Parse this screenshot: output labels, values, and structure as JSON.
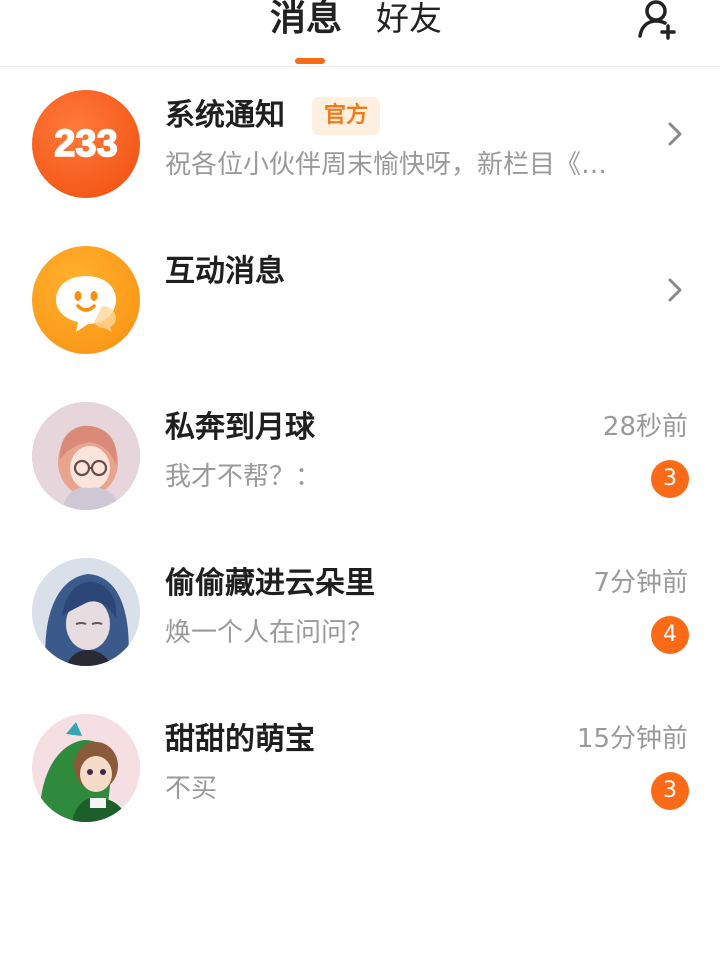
{
  "header": {
    "tabs": [
      {
        "label": "消息",
        "active": true
      },
      {
        "label": "好友",
        "active": false
      }
    ],
    "add_friend_icon": "add-person-icon",
    "accent_color": "#fa6a17"
  },
  "conversations": [
    {
      "name": "系统通知",
      "tag": "官方",
      "preview": "祝各位小伙伴周末愉快呀，新栏目《…",
      "avatar_text": "233",
      "avatar_icon": "logo-233-icon"
    },
    {
      "name": "互动消息",
      "preview": "",
      "avatar_icon": "chat-bubble-smile-icon"
    },
    {
      "name": "私奔到月球",
      "preview": "我才不帮？：",
      "time": "28秒前",
      "unread": "3"
    },
    {
      "name": "偷偷藏进云朵里",
      "preview": "焕一个人在问问？",
      "time": "7分钟前",
      "unread": "4"
    },
    {
      "name": "甜甜的萌宝",
      "preview": "不买",
      "time": "15分钟前",
      "unread": "3"
    }
  ]
}
